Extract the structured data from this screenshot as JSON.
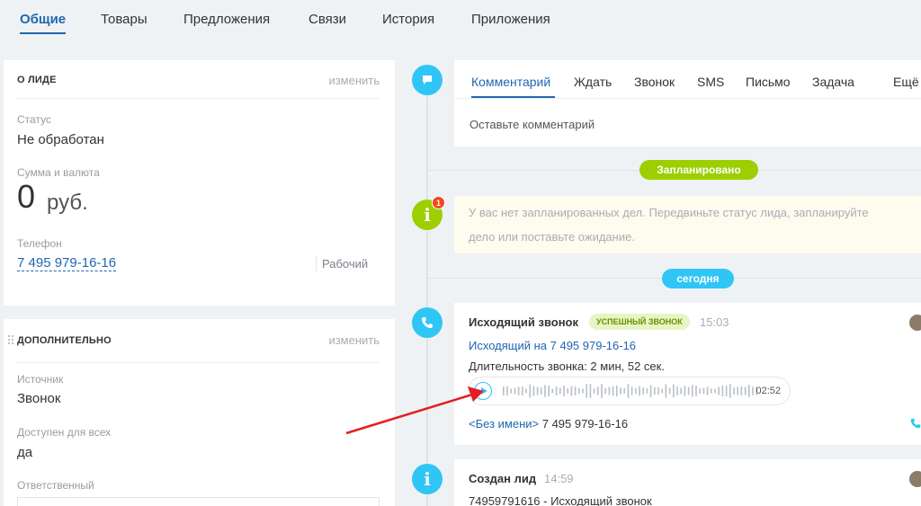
{
  "tabs": [
    "Общие",
    "Товары",
    "Предложения",
    "Связи",
    "История",
    "Приложения"
  ],
  "lead": {
    "title": "О ЛИДЕ",
    "edit": "изменить",
    "status_label": "Статус",
    "status_value": "Не обработан",
    "sum_label": "Сумма и валюта",
    "sum_value": "0",
    "currency": "руб.",
    "phone_label": "Телефон",
    "phone_value": "7 495 979-16-16",
    "phone_type": "Рабочий"
  },
  "extra": {
    "title": "ДОПОЛНИТЕЛЬНО",
    "edit": "изменить",
    "source_label": "Источник",
    "source_value": "Звонок",
    "access_label": "Доступен для всех",
    "access_value": "да",
    "owner_label": "Ответственный"
  },
  "composer": {
    "tabs": [
      "Комментарий",
      "Ждать",
      "Звонок",
      "SMS",
      "Письмо",
      "Задача",
      "Ещё"
    ],
    "placeholder": "Оставьте комментарий"
  },
  "planned": {
    "badge": "Запланировано",
    "count": "1",
    "text_line1": "У вас нет запланированных дел. Передвиньте статус лида, запланируйте",
    "text_line2": "дело или поставьте ожидание."
  },
  "today_badge": "сегодня",
  "call": {
    "title": "Исходящий звонок",
    "status": "УСПЕШНЫЙ ЗВОНОК",
    "time": "15:03",
    "link": "Исходящий на 7 495 979-16-16",
    "duration": "Длительность звонка: 2 мин, 52 сек.",
    "player_time": "02:52",
    "contact_link": "<Без имени>",
    "contact_phone": "7 495 979-16-16"
  },
  "created": {
    "title": "Создан лид",
    "time": "14:59",
    "text": "74959791616 - Исходящий звонок"
  },
  "colors": {
    "accent": "#2067b0",
    "timeline_blue": "#2fc6f6",
    "timeline_green": "#9dcf00",
    "arrow": "#e31e24"
  }
}
